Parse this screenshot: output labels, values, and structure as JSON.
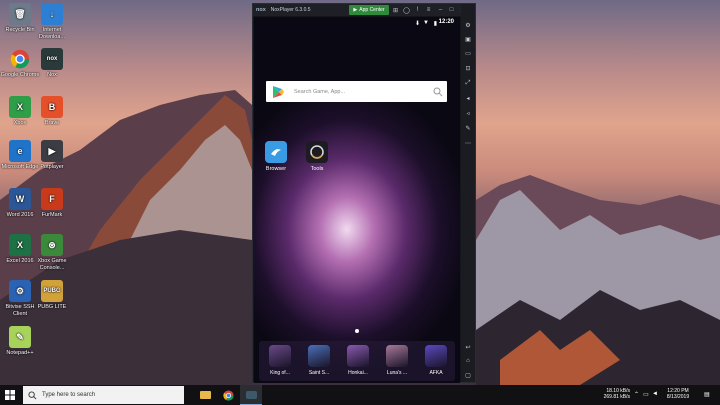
{
  "desktop": {
    "icons": [
      {
        "label": "Recycle Bin",
        "glyph": "🗑",
        "color": "#6c7a89",
        "name": "recycle-bin-icon"
      },
      {
        "label": "Internet Downloa...",
        "glyph": "↓",
        "color": "#2d7fd3",
        "name": "internet-download-icon"
      },
      {
        "label": "Google Chrome",
        "glyph": "",
        "color": "#ffffff",
        "name": "chrome-icon"
      },
      {
        "label": "Nox",
        "glyph": "nox",
        "color": "#2a3a3a",
        "name": "nox-icon"
      },
      {
        "label": "Xbox",
        "glyph": "X",
        "color": "#2e9e49",
        "name": "xbox-icon"
      },
      {
        "label": "Brave",
        "glyph": "B",
        "color": "#e5502b",
        "name": "brave-icon"
      },
      {
        "label": "Microsoft Edge",
        "glyph": "e",
        "color": "#1f73c9",
        "name": "edge-icon"
      },
      {
        "label": "Potplayer",
        "glyph": "▶",
        "color": "#3c3c44",
        "name": "potplayer-icon"
      },
      {
        "label": "Word 2016",
        "glyph": "W",
        "color": "#2b5797",
        "name": "word-icon"
      },
      {
        "label": "FurMark",
        "glyph": "F",
        "color": "#c83a1a",
        "name": "furmark-icon"
      },
      {
        "label": "Excel 2016",
        "glyph": "X",
        "color": "#1e7145",
        "name": "excel-icon"
      },
      {
        "label": "Xbox Game Console...",
        "glyph": "⊛",
        "color": "#3b8a3b",
        "name": "xbox-console-icon"
      },
      {
        "label": "Bitvise SSH Client",
        "glyph": "⚙",
        "color": "#2a62b4",
        "name": "bitvise-icon"
      },
      {
        "label": "PUBG LITE",
        "glyph": "PUBG",
        "color": "#d2a23a",
        "name": "pubg-icon"
      },
      {
        "label": "Notepad++",
        "glyph": "✎",
        "color": "#a8d35a",
        "name": "notepad-icon"
      }
    ]
  },
  "nox": {
    "logo": "nox",
    "title": "NoxPlayer 6.3.0.5",
    "app_center": "App Center",
    "time": "12:20",
    "search_placeholder": "Search Game, App...",
    "apps": [
      {
        "label": "Browser",
        "color": "#3a9be5"
      },
      {
        "label": "Tools",
        "color": "#1c1c22"
      }
    ],
    "dock": [
      {
        "label": "King of...",
        "color": "#6a4a8a"
      },
      {
        "label": "Saint S...",
        "color": "#4a70b8"
      },
      {
        "label": "Honkai...",
        "color": "#8a5ab0"
      },
      {
        "label": "Luna's ...",
        "color": "#a87a9a"
      },
      {
        "label": "AFKA",
        "color": "#5a4ac0"
      }
    ]
  },
  "taskbar": {
    "search_placeholder": "Type here to search",
    "net_up": "18.10 kB/s",
    "net_down": "269.81 kB/s",
    "clock_time": "12:20 PM",
    "clock_date": "8/13/2019"
  }
}
